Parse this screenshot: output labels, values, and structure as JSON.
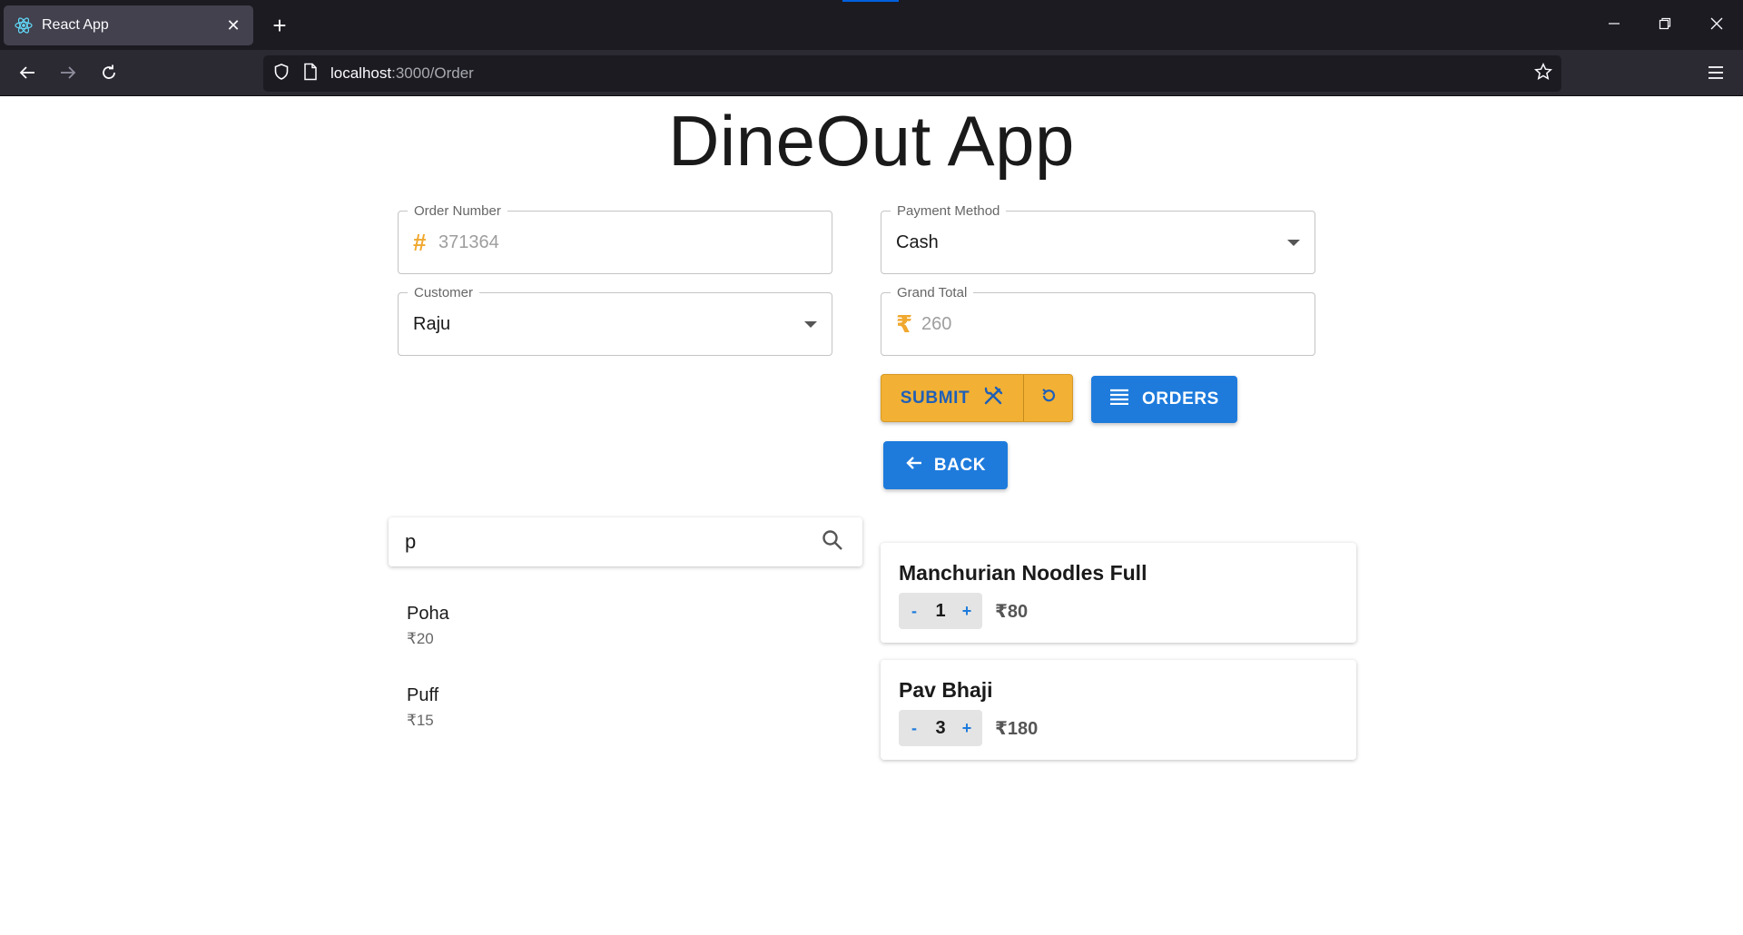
{
  "browser": {
    "tab_title": "React App",
    "url_host": "localhost",
    "url_path": ":3000/Order"
  },
  "app": {
    "title": "DineOut App"
  },
  "form": {
    "order_number": {
      "label": "Order Number",
      "adornment": "#",
      "value": "371364"
    },
    "payment_method": {
      "label": "Payment Method",
      "value": "Cash"
    },
    "customer": {
      "label": "Customer",
      "value": "Raju"
    },
    "grand_total": {
      "label": "Grand Total",
      "adornment": "₹",
      "value": "260"
    }
  },
  "actions": {
    "submit_label": "SUBMIT",
    "orders_label": "ORDERS",
    "back_label": "BACK"
  },
  "search": {
    "value": "p"
  },
  "menu_items": [
    {
      "name": "Poha",
      "price": "₹20"
    },
    {
      "name": "Puff",
      "price": "₹15"
    }
  ],
  "order_items": [
    {
      "name": "Manchurian Noodles Full",
      "qty": "1",
      "price": "₹80"
    },
    {
      "name": "Pav Bhaji",
      "qty": "3",
      "price": "₹180"
    }
  ],
  "stepper_labels": {
    "minus": "-",
    "plus": "+"
  },
  "colors": {
    "accent_orange": "#f2b134",
    "accent_blue": "#1e7bdc"
  }
}
